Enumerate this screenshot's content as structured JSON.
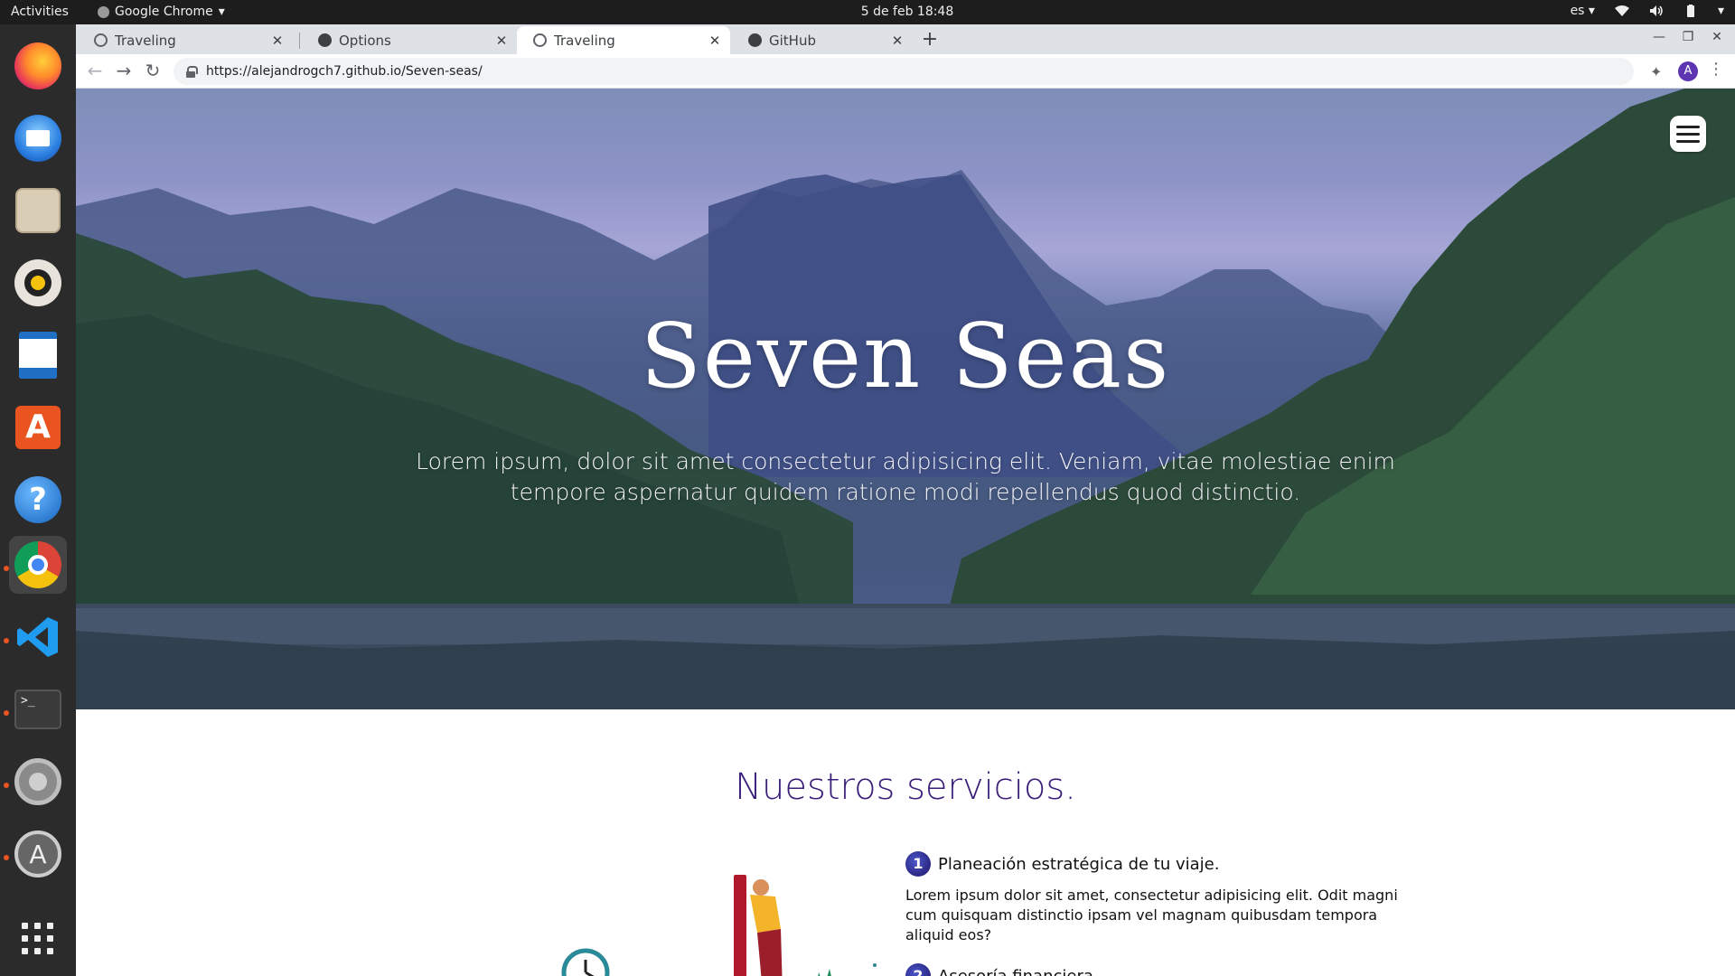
{
  "topbar": {
    "activities": "Activities",
    "app_name": "Google Chrome",
    "clock": "5 de feb  18:48",
    "language": "es"
  },
  "dock": {
    "items": [
      {
        "name": "firefox",
        "icon": "firefox-icon"
      },
      {
        "name": "thunderbird",
        "icon": "mail-icon"
      },
      {
        "name": "files",
        "icon": "folder-icon"
      },
      {
        "name": "rhythmbox",
        "icon": "speaker-icon"
      },
      {
        "name": "libreoffice-writer",
        "icon": "document-icon"
      },
      {
        "name": "ubuntu-software",
        "icon": "store-icon"
      },
      {
        "name": "help",
        "icon": "help-icon"
      },
      {
        "name": "chrome",
        "icon": "chrome-icon"
      },
      {
        "name": "vscode",
        "icon": "vscode-icon"
      },
      {
        "name": "terminal",
        "icon": "terminal-icon"
      },
      {
        "name": "settings",
        "icon": "gear-icon"
      },
      {
        "name": "software-updater",
        "icon": "updater-icon"
      },
      {
        "name": "show-apps",
        "icon": "grid-icon"
      }
    ]
  },
  "browser": {
    "tabs": [
      {
        "title": "Traveling",
        "icon": "globe-icon",
        "active": false
      },
      {
        "title": "Options",
        "icon": "github-icon",
        "active": false
      },
      {
        "title": "Traveling",
        "icon": "globe-icon",
        "active": true
      },
      {
        "title": "GitHub",
        "icon": "github-icon",
        "active": false
      }
    ],
    "url": "https://alejandrogch7.github.io/Seven-seas/",
    "profile_initial": "A"
  },
  "page": {
    "hero": {
      "title": "Seven Seas",
      "subtitle": "Lorem ipsum, dolor sit amet consectetur adipisicing elit. Veniam, vitae molestiae enim tempore aspernatur quidem ratione modi repellendus quod distinctio."
    },
    "services": {
      "title": "Nuestros servicios.",
      "items": [
        {
          "number": "1",
          "title": "Planeación estratégica de tu viaje.",
          "text": "Lorem ipsum dolor sit amet, consectetur adipisicing elit. Odit magni cum quisquam distinctio ipsam vel magnam quibusdam tempora aliquid eos?"
        },
        {
          "number": "2",
          "title": "Asesoría financiera"
        }
      ]
    }
  },
  "colors": {
    "services_title": "#3a1e7a",
    "ubuntu_accent": "#e95420",
    "profile": "#5e35b1"
  }
}
